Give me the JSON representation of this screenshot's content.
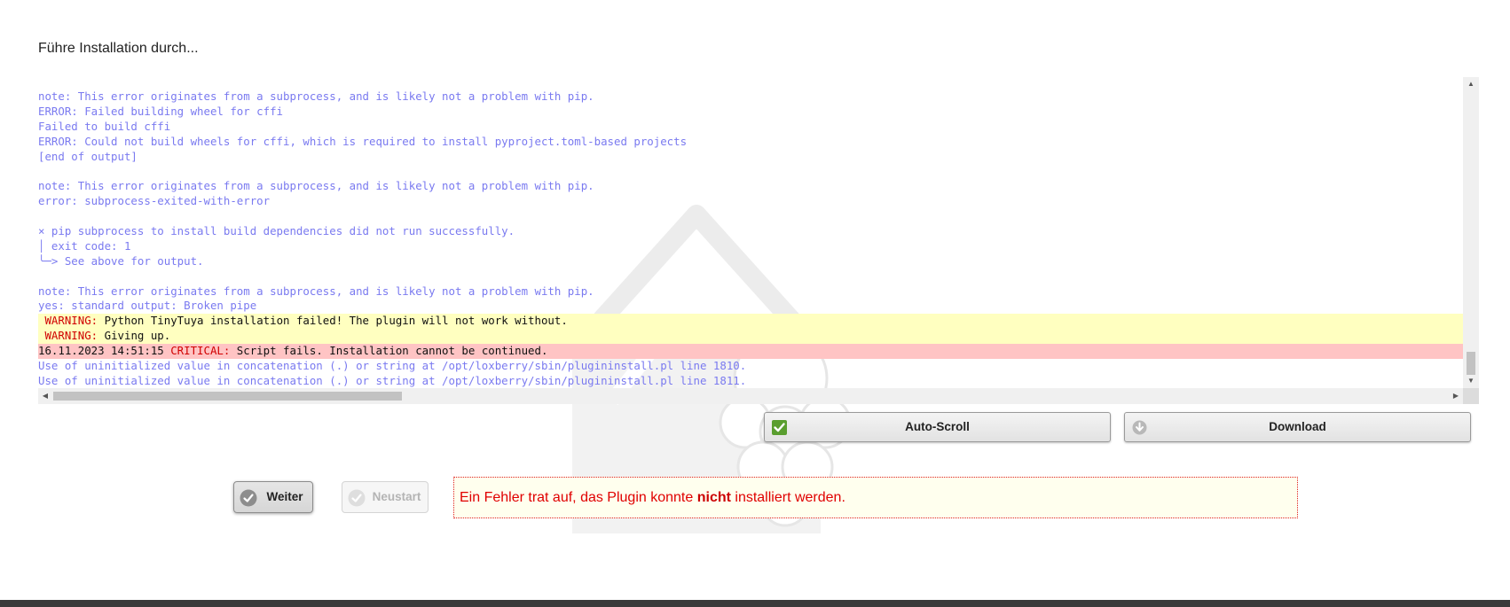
{
  "heading": "Führe Installation durch...",
  "log": {
    "lines": [
      {
        "type": "normal",
        "text": "note: This error originates from a subprocess, and is likely not a problem with pip."
      },
      {
        "type": "normal",
        "text": "ERROR: Failed building wheel for cffi"
      },
      {
        "type": "normal",
        "text": "Failed to build cffi"
      },
      {
        "type": "normal",
        "text": "ERROR: Could not build wheels for cffi, which is required to install pyproject.toml-based projects"
      },
      {
        "type": "normal",
        "text": "[end of output]"
      },
      {
        "type": "normal",
        "text": ""
      },
      {
        "type": "normal",
        "text": "note: This error originates from a subprocess, and is likely not a problem with pip."
      },
      {
        "type": "normal",
        "text": "error: subprocess-exited-with-error"
      },
      {
        "type": "normal",
        "text": ""
      },
      {
        "type": "normal",
        "text": "× pip subprocess to install build dependencies did not run successfully."
      },
      {
        "type": "normal",
        "text": "│ exit code: 1"
      },
      {
        "type": "normal",
        "text": "╰─> See above for output."
      },
      {
        "type": "normal",
        "text": ""
      },
      {
        "type": "normal",
        "text": "note: This error originates from a subprocess, and is likely not a problem with pip."
      },
      {
        "type": "normal",
        "text": "yes: standard output: Broken pipe"
      },
      {
        "type": "warning",
        "prefix": " ",
        "level": "WARNING:",
        "text": " Python TinyTuya installation failed! The plugin will not work without."
      },
      {
        "type": "warning",
        "prefix": " ",
        "level": "WARNING:",
        "text": " Giving up."
      },
      {
        "type": "critical",
        "prefix": "16.11.2023 14:51:15 ",
        "level": "CRITICAL:",
        "text": " Script fails. Installation cannot be continued."
      },
      {
        "type": "normal",
        "text": "Use of uninitialized value in concatenation (.) or string at /opt/loxberry/sbin/plugininstall.pl line 1810."
      },
      {
        "type": "normal",
        "text": "Use of uninitialized value in concatenation (.) or string at /opt/loxberry/sbin/plugininstall.pl line 1811."
      }
    ]
  },
  "buttons": {
    "autoscroll": "Auto-Scroll",
    "download": "Download",
    "weiter": "Weiter",
    "neustart": "Neustart"
  },
  "error_message": {
    "before": "Ein Fehler trat auf, das Plugin konnte ",
    "bold": "nicht",
    "after": " installiert werden."
  },
  "icons": {
    "autoscroll": "checkbox-checked-icon",
    "download": "download-arrow-icon",
    "weiter": "check-circle-icon",
    "neustart": "check-circle-icon"
  },
  "colors": {
    "log_text": "#7a7af0",
    "warning_bg": "#ffffc0",
    "critical_bg": "#ffc4c4",
    "error_text": "#e00000",
    "error_bg": "#ffffee",
    "checkbox_green": "#5a9e2f"
  }
}
